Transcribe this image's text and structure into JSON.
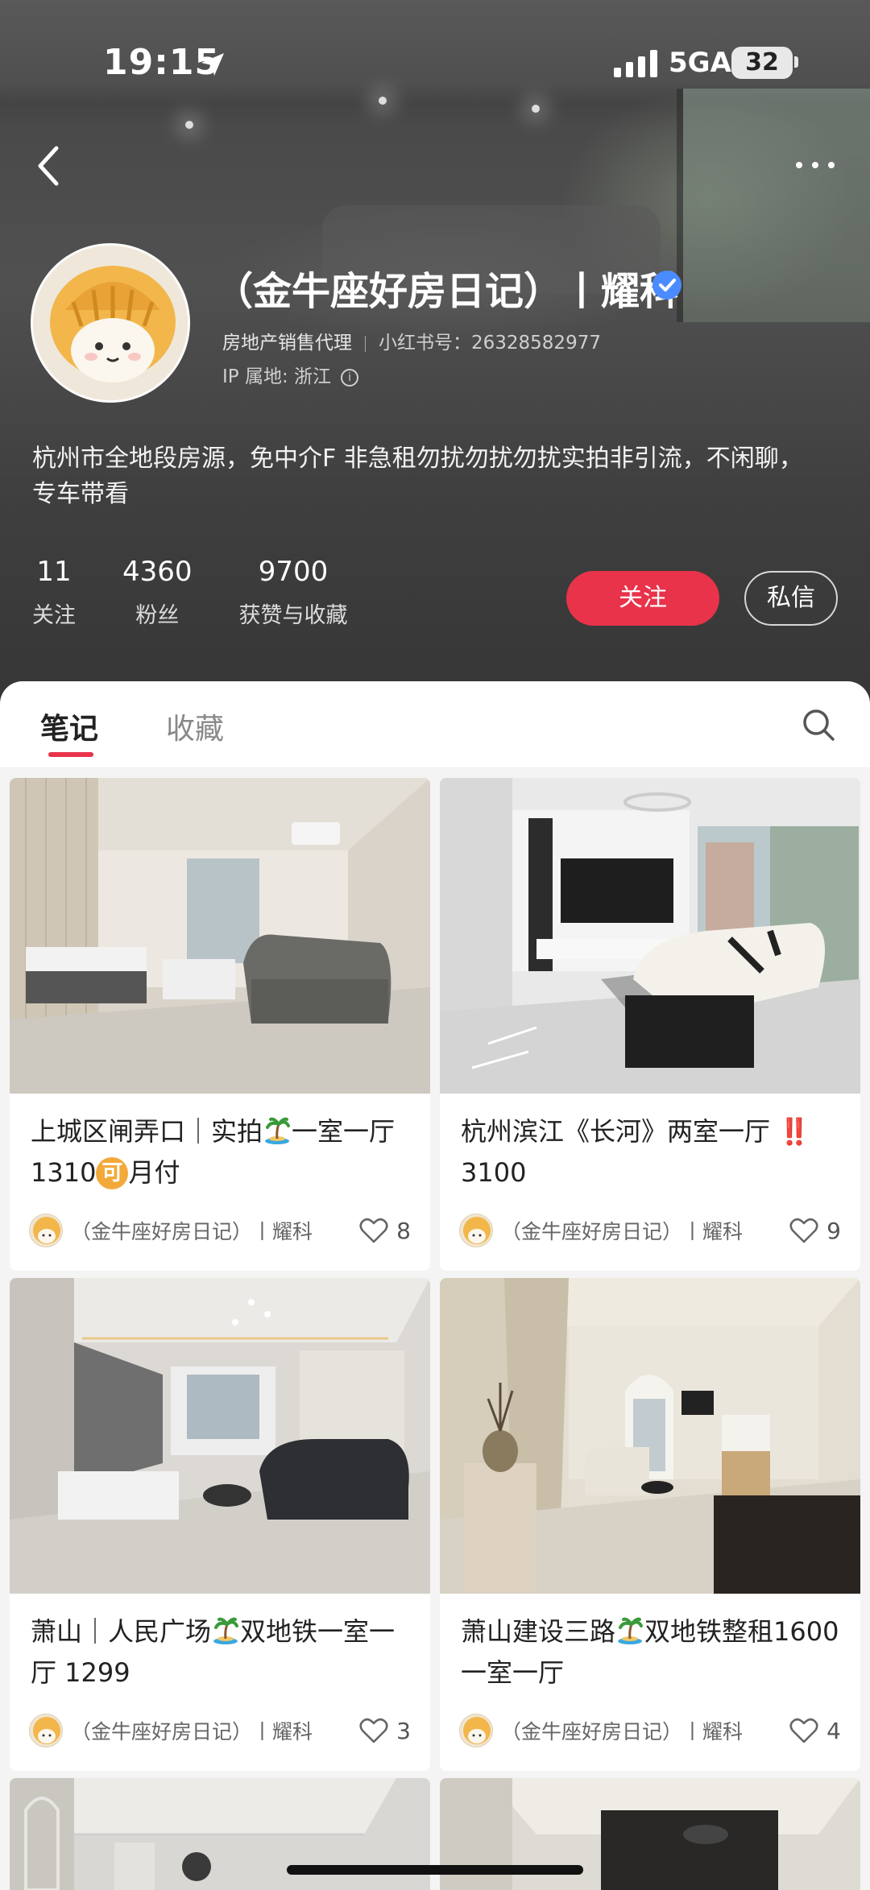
{
  "status_bar": {
    "time": "19:15",
    "network": "5GA",
    "battery": "32"
  },
  "profile": {
    "name": "（金牛座好房日记）丨耀科",
    "role": "房地产销售代理",
    "id_label": "小红书号：26328582977",
    "ip_label": "IP 属地: 浙江",
    "bio": "杭州市全地段房源，免中介F 非急租勿扰勿扰勿扰实拍非引流，不闲聊，专车带看",
    "stats": [
      {
        "num": "11",
        "label": "关注"
      },
      {
        "num": "4360",
        "label": "粉丝"
      },
      {
        "num": "9700",
        "label": "获赞与收藏"
      }
    ],
    "follow_label": "关注",
    "message_label": "私信"
  },
  "tabs": [
    {
      "label": "笔记"
    },
    {
      "label": "收藏"
    }
  ],
  "notes": [
    {
      "title_a": "上城区闸弄口｜实拍",
      "title_b": "一室一厅1310",
      "title_c": "月付",
      "coin": "可",
      "author": "（金牛座好房日记）丨耀科",
      "likes": "8"
    },
    {
      "title_a": "杭州滨江《长河》两室一厅",
      "title_b": "‼️",
      "title_c": "3100",
      "author": "（金牛座好房日记）丨耀科",
      "likes": "9"
    },
    {
      "title_a": "萧山｜人民广场",
      "title_b": "双地铁一室一厅 1299",
      "author": "（金牛座好房日记）丨耀科",
      "likes": "3"
    },
    {
      "title_a": "萧山建设三路",
      "title_b": "双地铁整租1600一室一厅",
      "author": "（金牛座好房日记）丨耀科",
      "likes": "4"
    }
  ],
  "colors": {
    "accent": "#e8334a",
    "verified": "#4a8cff"
  }
}
